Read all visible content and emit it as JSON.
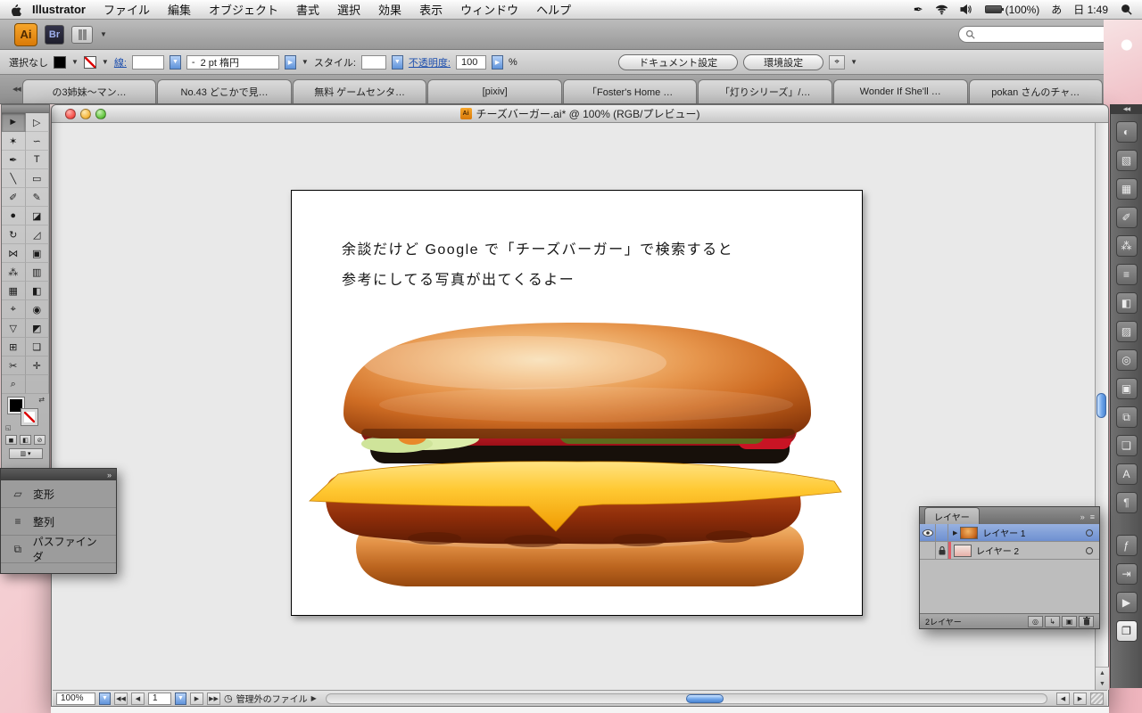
{
  "menubar": {
    "app": "Illustrator",
    "items": [
      "ファイル",
      "編集",
      "オブジェクト",
      "書式",
      "選択",
      "効果",
      "表示",
      "ウィンドウ",
      "ヘルプ"
    ],
    "battery": "(100%)",
    "ime": "あ",
    "clock": "日 1:49"
  },
  "appbar": {
    "ai": "Ai",
    "br": "Br"
  },
  "controlbar": {
    "selection": "選択なし",
    "stroke_label": "線:",
    "brush_prefix": "-",
    "brush": "2 pt 楕円",
    "style_label": "スタイル:",
    "opacity_label": "不透明度:",
    "opacity_value": "100",
    "percent": "%",
    "doc_setup": "ドキュメント設定",
    "prefs": "環境設定"
  },
  "tabs": [
    "の3姉妹〜マン…",
    "No.43 どこかで見…",
    "無料 ゲームセンタ…",
    "[pixiv]",
    "「Foster's Home …",
    "「灯りシリーズ」/…",
    "Wonder If She'll …",
    "pokan さんのチャ…"
  ],
  "doc": {
    "title": "チーズバーガー.ai* @ 100% (RGB/プレビュー)"
  },
  "artboard": {
    "line1": "余談だけど Google で「チーズバーガー」で検索すると",
    "line2": "参考にしてる写真が出てくるよー"
  },
  "tools": [
    {
      "name": "selection-tool",
      "glyph": "►",
      "active": true
    },
    {
      "name": "direct-selection-tool",
      "glyph": "▷"
    },
    {
      "name": "magic-wand-tool",
      "glyph": "✶"
    },
    {
      "name": "lasso-tool",
      "glyph": "∽"
    },
    {
      "name": "pen-tool",
      "glyph": "✒"
    },
    {
      "name": "type-tool",
      "glyph": "T"
    },
    {
      "name": "line-tool",
      "glyph": "╲"
    },
    {
      "name": "rectangle-tool",
      "glyph": "▭"
    },
    {
      "name": "paintbrush-tool",
      "glyph": "✐"
    },
    {
      "name": "pencil-tool",
      "glyph": "✎"
    },
    {
      "name": "blob-brush-tool",
      "glyph": "●"
    },
    {
      "name": "eraser-tool",
      "glyph": "◪"
    },
    {
      "name": "rotate-tool",
      "glyph": "↻"
    },
    {
      "name": "scale-tool",
      "glyph": "◿"
    },
    {
      "name": "width-tool",
      "glyph": "⋈"
    },
    {
      "name": "free-transform-tool",
      "glyph": "▣"
    },
    {
      "name": "symbol-sprayer-tool",
      "glyph": "⁂"
    },
    {
      "name": "graph-tool",
      "glyph": "▥"
    },
    {
      "name": "mesh-tool",
      "glyph": "▦"
    },
    {
      "name": "gradient-tool",
      "glyph": "◧"
    },
    {
      "name": "eyedropper-tool",
      "glyph": "⌖"
    },
    {
      "name": "blend-tool",
      "glyph": "◉"
    },
    {
      "name": "live-paint-bucket-tool",
      "glyph": "▽"
    },
    {
      "name": "live-paint-selection-tool",
      "glyph": "◩"
    },
    {
      "name": "perspective-grid-tool",
      "glyph": "⊞"
    },
    {
      "name": "artboard-tool",
      "glyph": "❏"
    },
    {
      "name": "slice-tool",
      "glyph": "✂"
    },
    {
      "name": "hand-tool",
      "glyph": "✛"
    },
    {
      "name": "zoom-tool",
      "glyph": "⌕"
    },
    {
      "name": "empty-slot",
      "glyph": ""
    }
  ],
  "panel": {
    "items": [
      {
        "name": "transform-item",
        "glyph": "▱",
        "label": "変形"
      },
      {
        "name": "align-item",
        "glyph": "≡",
        "label": "整列"
      },
      {
        "name": "pathfinder-item",
        "glyph": "⧉",
        "label": "パスファインダ"
      }
    ]
  },
  "dock": {
    "icons": [
      {
        "name": "color-panel-icon",
        "glyph": "◐"
      },
      {
        "name": "color-guide-panel-icon",
        "glyph": "▧"
      },
      {
        "name": "swatches-panel-icon",
        "glyph": "▦"
      },
      {
        "name": "brushes-panel-icon",
        "glyph": "✐"
      },
      {
        "name": "symbols-panel-icon",
        "glyph": "⁂"
      },
      {
        "name": "stroke-panel-icon",
        "glyph": "≡"
      },
      {
        "name": "gradient-panel-icon",
        "glyph": "◧"
      },
      {
        "name": "transparency-panel-icon",
        "glyph": "▨"
      },
      {
        "name": "appearance-panel-icon",
        "glyph": "◎"
      },
      {
        "name": "graphic-styles-panel-icon",
        "glyph": "▣"
      },
      {
        "name": "links-panel-icon",
        "glyph": "⧉"
      },
      {
        "name": "artboards-panel-icon",
        "glyph": "❏"
      },
      {
        "name": "character-panel-icon",
        "glyph": "A"
      },
      {
        "name": "paragraph-panel-icon",
        "glyph": "¶"
      },
      {
        "name": "opentype-panel-icon",
        "glyph": "ƒ",
        "gap": true
      },
      {
        "name": "tabs-panel-icon",
        "glyph": "⇥"
      },
      {
        "name": "actions-panel-icon",
        "glyph": "▶"
      },
      {
        "name": "layers-panel-icon",
        "glyph": "❐",
        "selected": true
      }
    ]
  },
  "layers": {
    "tab": "レイヤー",
    "rows": [
      {
        "name": "レイヤー 1"
      },
      {
        "name": "レイヤー 2"
      }
    ],
    "footer": "2レイヤー"
  },
  "statusbar": {
    "zoom": "100%",
    "page": "1",
    "status": "管理外のファイル"
  },
  "colors": {
    "accent_blue": "#4b86d2",
    "ai_orange": "#e88a1a",
    "desktop_pink": "#f2c3c9",
    "selected_row_blue": "#6e90d1"
  }
}
